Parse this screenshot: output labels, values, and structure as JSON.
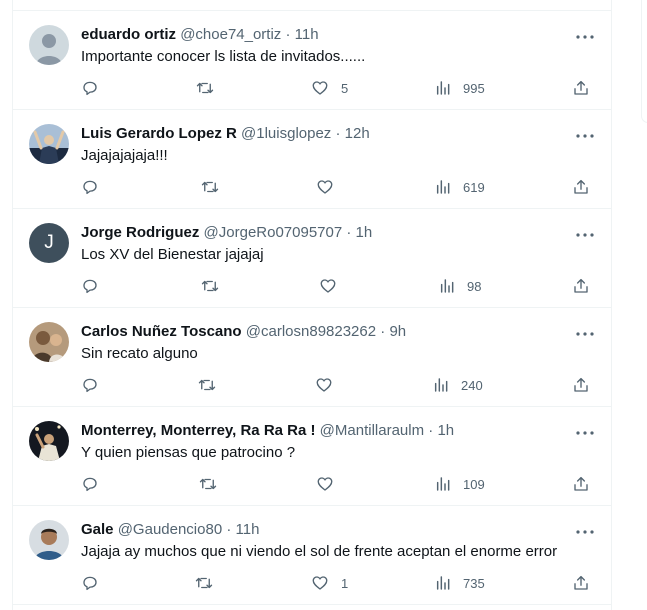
{
  "colors": {
    "text": "#0f1419",
    "secondary": "#536471",
    "border": "#eff3f4"
  },
  "separator": "·",
  "tweets": [
    {
      "name": "eduardo ortiz",
      "handle": "@choe74_ortiz",
      "time": "11h",
      "text": "Importante conocer ls lista de invitados......",
      "replies": "",
      "retweets": "",
      "likes": "5",
      "views": "995",
      "avatar": "default-avatar-icon"
    },
    {
      "name": "Luis Gerardo Lopez R",
      "handle": "@1luisglopez",
      "time": "12h",
      "text": "Jajajajajaja!!!",
      "replies": "",
      "retweets": "",
      "likes": "",
      "views": "619",
      "avatar": "user-photo-icon"
    },
    {
      "name": "Jorge Rodriguez",
      "handle": "@JorgeRo07095707",
      "time": "1h",
      "text": "Los XV del Bienestar jajajaj",
      "replies": "",
      "retweets": "",
      "likes": "",
      "views": "98",
      "avatar": "initial-avatar",
      "initial": "J"
    },
    {
      "name": "Carlos Nuñez Toscano",
      "handle": "@carlosn89823262",
      "time": "9h",
      "text": "Sin recato alguno",
      "replies": "",
      "retweets": "",
      "likes": "",
      "views": "240",
      "avatar": "user-photo-icon"
    },
    {
      "name": "Monterrey, Monterrey, Ra Ra Ra !",
      "handle": "@Mantillaraulm",
      "time": "1h",
      "text": "Y quien piensas que patrocino ?",
      "replies": "",
      "retweets": "",
      "likes": "",
      "views": "109",
      "avatar": "user-photo-icon"
    },
    {
      "name": "Gale",
      "handle": "@Gaudencio80",
      "time": "11h",
      "text": "Jajaja ay muchos que ni viendo el sol de frente aceptan el enorme error",
      "replies": "",
      "retweets": "",
      "likes": "1",
      "views": "735",
      "avatar": "user-photo-icon"
    }
  ]
}
